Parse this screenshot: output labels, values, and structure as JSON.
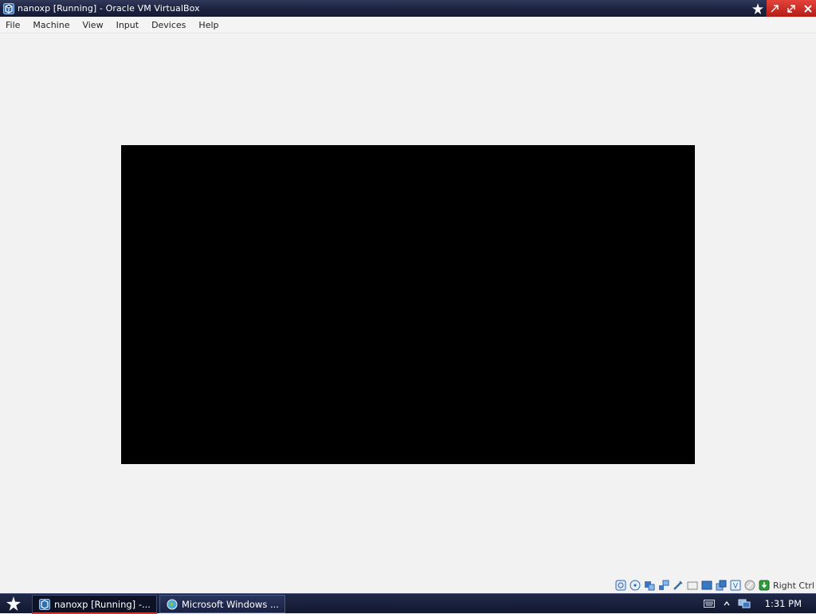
{
  "window": {
    "title": "nanoxp [Running] - Oracle VM VirtualBox",
    "icon": "virtualbox-icon",
    "controls": [
      "pin-icon",
      "minimize-icon",
      "maximize-icon",
      "close-icon"
    ]
  },
  "menu": {
    "items": [
      {
        "label": "File"
      },
      {
        "label": "Machine"
      },
      {
        "label": "View"
      },
      {
        "label": "Input"
      },
      {
        "label": "Devices"
      },
      {
        "label": "Help"
      }
    ]
  },
  "vm_display": {
    "state": "black screen",
    "color": "#000000"
  },
  "statusbar": {
    "icons": [
      "hard-disk-icon",
      "optical-drive-icon",
      "audio-icon",
      "network-icon",
      "usb-icon",
      "shared-folders-icon",
      "display-icon",
      "video-capture-icon",
      "virtualization-icon",
      "mouse-integration-icon",
      "keyboard-capture-icon"
    ],
    "host_key": "Right Ctrl"
  },
  "taskbar": {
    "start_icon": "star-icon",
    "tasks": [
      {
        "label": "nanoxp [Running] -...",
        "icon": "virtualbox-icon",
        "active": true
      },
      {
        "label": "Microsoft Windows ...",
        "icon": "globe-icon",
        "active": false
      }
    ],
    "tray": {
      "icons": [
        "keyboard-icon",
        "chevron-up-icon",
        "network-tray-icon"
      ],
      "clock": "1:31 PM"
    }
  },
  "colors": {
    "titlebar": "#1c2340",
    "close_group": "#c8302a",
    "background": "#f2f2f2",
    "taskbar": "#1a2140"
  }
}
